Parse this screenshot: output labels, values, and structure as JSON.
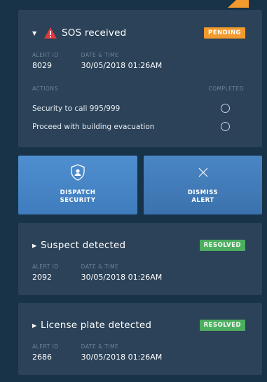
{
  "colors": {
    "background": "#183247",
    "card": "#2b4258",
    "pending": "#f29a2e",
    "resolved": "#4cae5f",
    "action_blue": "#4f8fcf",
    "muted": "#6d8499"
  },
  "alerts": [
    {
      "title": "SOS received",
      "status": "PENDING",
      "alert_id_label": "ALERT ID",
      "alert_id": "8029",
      "datetime_label": "DATE & TIME",
      "datetime": "30/05/2018 01:26AM",
      "icon": "warning-icon",
      "actions_label": "ACTIONS",
      "completed_label": "COMPLETED",
      "actions": [
        {
          "label": "Security to call 995/999",
          "completed": false
        },
        {
          "label": "Proceed with building evacuation",
          "completed": false
        }
      ]
    },
    {
      "title": "Suspect detected",
      "status": "RESOLVED",
      "alert_id_label": "ALERT ID",
      "alert_id": "2092",
      "datetime_label": "DATE & TIME",
      "datetime": "30/05/2018 01:26AM"
    },
    {
      "title": "License plate detected",
      "status": "RESOLVED",
      "alert_id_label": "ALERT ID",
      "alert_id": "2686",
      "datetime_label": "DATE & TIME",
      "datetime": "30/05/2018 01:26AM"
    }
  ],
  "buttons": {
    "dispatch": {
      "line1": "DISPATCH",
      "line2": "SECURITY",
      "icon": "shield-user-icon"
    },
    "dismiss": {
      "line1": "DISMISS",
      "line2": "ALERT",
      "icon": "close-icon"
    }
  }
}
